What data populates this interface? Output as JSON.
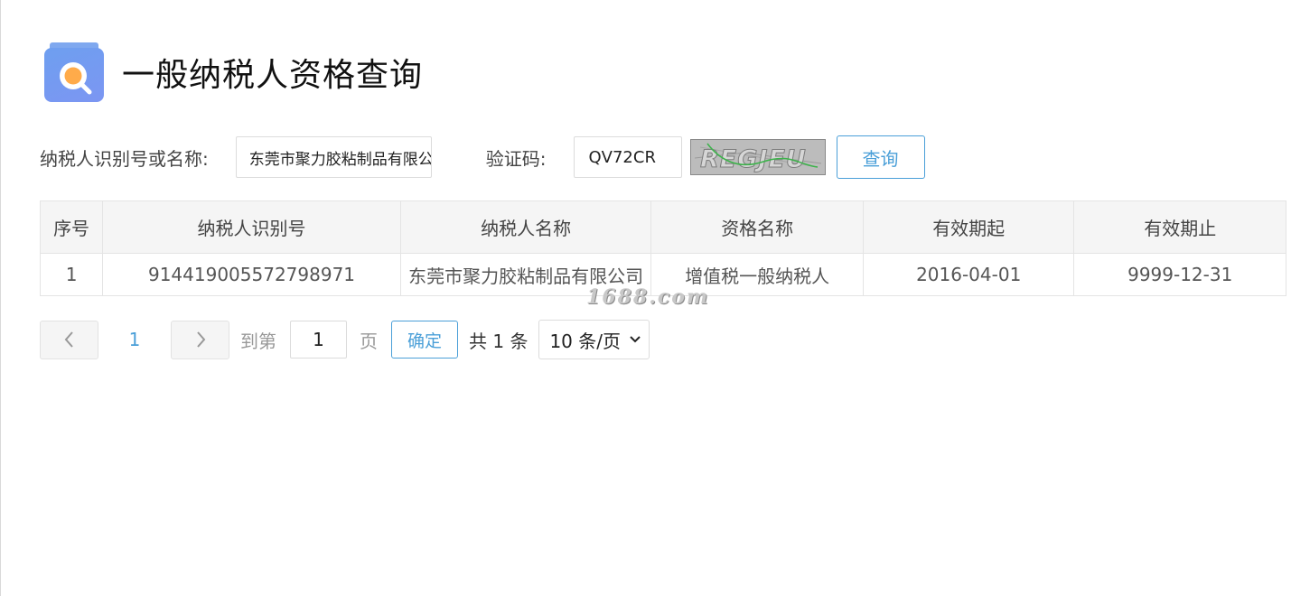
{
  "header": {
    "title": "一般纳税人资格查询",
    "logo_icon": "search-document-icon"
  },
  "search": {
    "name_label": "纳税人识别号或名称:",
    "name_value": "东莞市聚力胶粘制品有限公司",
    "captcha_label": "验证码:",
    "captcha_value": "QV72CR",
    "captcha_image_text": "REGJEU",
    "query_button": "查询"
  },
  "table": {
    "headers": [
      "序号",
      "纳税人识别号",
      "纳税人名称",
      "资格名称",
      "有效期起",
      "有效期止"
    ],
    "rows": [
      [
        "1",
        "914419005572798971",
        "东莞市聚力胶粘制品有限公司",
        "增值税一般纳税人",
        "2016-04-01",
        "9999-12-31"
      ]
    ]
  },
  "watermark": "1688.com",
  "pagination": {
    "current_page": "1",
    "goto_label": "到第",
    "goto_value": "1",
    "page_suffix": "页",
    "confirm_button": "确定",
    "total_text": "共 1 条",
    "page_size": "10 条/页"
  },
  "colors": {
    "accent": "#4a9fd8",
    "header_bg": "#f5f5f5",
    "logo": "#7c96f2"
  }
}
